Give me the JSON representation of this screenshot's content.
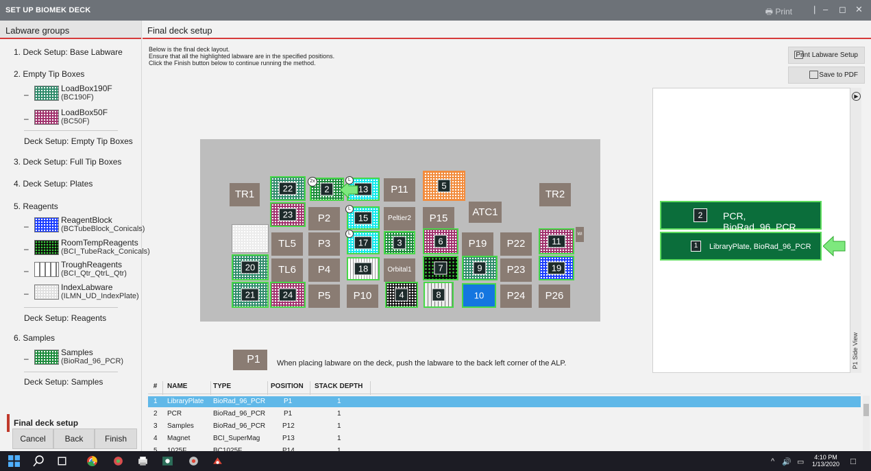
{
  "window": {
    "title": "SET UP BIOMEK DECK",
    "print_label": "Print"
  },
  "sidebar": {
    "header": "Labware groups",
    "steps": [
      "1. Deck Setup: Base Labware",
      "2. Empty Tip Boxes",
      "Deck Setup: Empty Tip Boxes",
      "3. Deck Setup: Full Tip Boxes",
      "4. Deck Setup: Plates",
      "5. Reagents",
      "Deck Setup: Reagents",
      "6. Samples",
      "Deck Setup: Samples",
      "Final deck setup"
    ],
    "labware": [
      {
        "name": "LoadBox190F",
        "code": "(BC190F)",
        "color": "#2e8a6a"
      },
      {
        "name": "LoadBox50F",
        "code": "(BC50F)",
        "color": "#a0306c"
      },
      {
        "name": "ReagentBlock",
        "code": "(BCTubeBlock_Conicals)",
        "color": "#1a3cff"
      },
      {
        "name": "RoomTempReagents",
        "code": "(BCI_TubeRack_Conicals)",
        "color": "#0a0a0a"
      },
      {
        "name": "TroughReagents",
        "code": "(BCI_Qtr_QtrL_Qtr)",
        "color": "#9a9a9a"
      },
      {
        "name": "IndexLabware",
        "code": "(ILMN_UD_IndexPlate)",
        "color": "#d8d8d8"
      },
      {
        "name": "Samples",
        "code": "(BioRad_96_PCR)",
        "color": "#1a8a3a"
      }
    ],
    "buttons": {
      "cancel": "Cancel",
      "back": "Back",
      "finish": "Finish"
    }
  },
  "main": {
    "header": "Final deck setup",
    "instructions": [
      "Below is the final deck layout.",
      "Ensure that all the highlighted labware are in the specified positions.",
      "Click the Finish button below to continue running the method."
    ],
    "print_labware_setup": "Print Labware Setup",
    "save_to_pdf": "Save to PDF",
    "deck_note_position": "P1",
    "deck_note": "When placing labware on the deck, push the labware to the back left corner of the ALP."
  },
  "deck": {
    "positions": [
      "TR1",
      "P11",
      "ATC1",
      "TR2",
      "P2",
      "Peltier2",
      "P15",
      "TL5",
      "P3",
      "P19",
      "P22",
      "TL6",
      "P4",
      "Orbital1",
      "P23",
      "P5",
      "P10",
      "P24",
      "P26"
    ],
    "labware_numbers": [
      "22",
      "2",
      "13",
      "5",
      "23",
      "15",
      "17",
      "3",
      "6",
      "11",
      "20",
      "18",
      "7",
      "9",
      "19",
      "21",
      "24",
      "4",
      "8",
      "10"
    ],
    "stack_badge": "2x",
    "small_marks": [
      "L",
      "L",
      "L",
      "L"
    ],
    "side_mark": "WI"
  },
  "side_view": {
    "label": "P1 Side View",
    "items": [
      {
        "number": "2",
        "label": "PCR, BioRad_96_PCR"
      },
      {
        "number": "1",
        "label": "LibraryPlate, BioRad_96_PCR"
      }
    ]
  },
  "table": {
    "headers": [
      "#",
      "NAME",
      "TYPE",
      "POSITION",
      "STACK DEPTH"
    ],
    "rows": [
      [
        "1",
        "LibraryPlate",
        "BioRad_96_PCR",
        "P1",
        "1"
      ],
      [
        "2",
        "PCR",
        "BioRad_96_PCR",
        "P1",
        "1"
      ],
      [
        "3",
        "Samples",
        "BioRad_96_PCR",
        "P12",
        "1"
      ],
      [
        "4",
        "Magnet",
        "BCI_SuperMag",
        "P13",
        "1"
      ],
      [
        "5",
        "1025F",
        "BC1025F",
        "P14",
        "1"
      ]
    ]
  },
  "taskbar": {
    "time": "4:10 PM",
    "date": "1/13/2020"
  }
}
